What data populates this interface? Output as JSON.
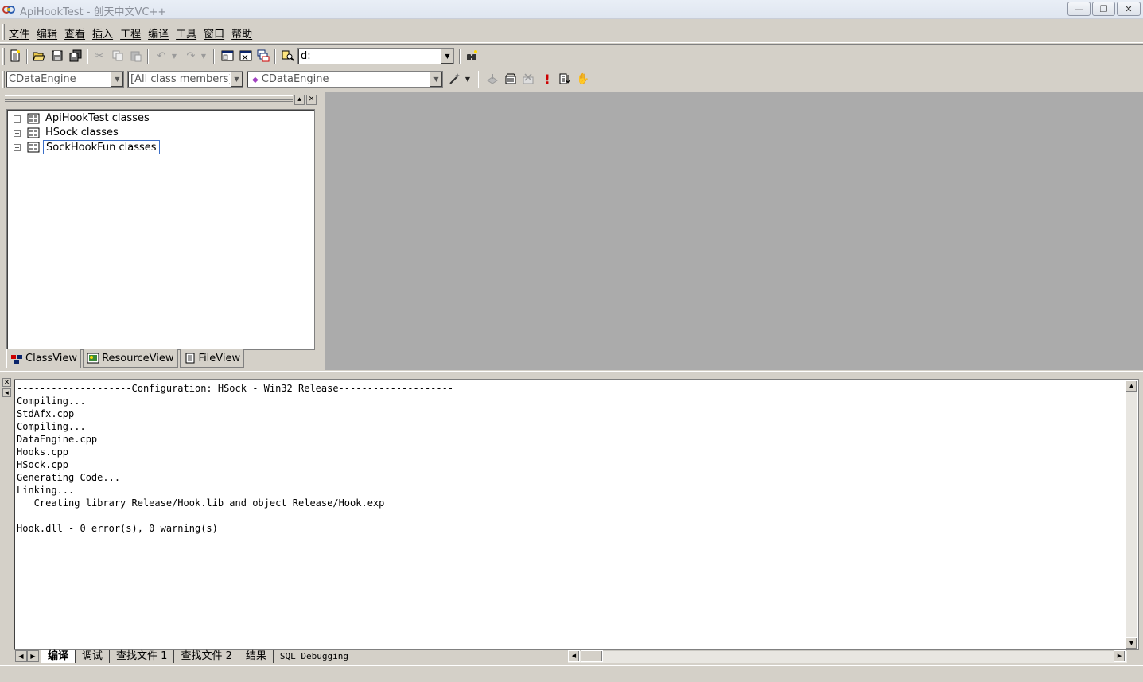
{
  "window": {
    "title": "ApiHookTest - 创天中文VC++",
    "minimize_glyph": "—",
    "maximize_glyph": "❐",
    "close_glyph": "✕"
  },
  "menu": [
    "文件",
    "编辑",
    "查看",
    "插入",
    "工程",
    "编译",
    "工具",
    "窗口",
    "帮助"
  ],
  "toolbar": {
    "find_combo_value": "d:",
    "wizard_class_combo": "CDataEngine",
    "wizard_filter_combo": "[All class members]",
    "wizard_member_combo": "CDataEngine",
    "combo_arrow": "▼"
  },
  "workspace": {
    "tree": [
      {
        "label": "ApiHookTest classes",
        "expander": "+",
        "selected": false
      },
      {
        "label": "HSock classes",
        "expander": "+",
        "selected": false
      },
      {
        "label": "SockHookFun classes",
        "expander": "+",
        "selected": true
      }
    ],
    "tabs": [
      {
        "label": "ClassView",
        "active": true
      },
      {
        "label": "ResourceView",
        "active": false
      },
      {
        "label": "FileView",
        "active": false
      }
    ],
    "dock_glyph": "▴",
    "close_glyph": "✕"
  },
  "output": {
    "lines": [
      "--------------------Configuration: HSock - Win32 Release--------------------",
      "Compiling...",
      "StdAfx.cpp",
      "Compiling...",
      "DataEngine.cpp",
      "Hooks.cpp",
      "HSock.cpp",
      "Generating Code...",
      "Linking...",
      "   Creating library Release/Hook.lib and object Release/Hook.exp",
      "",
      "Hook.dll - 0 error(s), 0 warning(s)"
    ],
    "tabs": [
      {
        "label": "编译",
        "active": true
      },
      {
        "label": "调试",
        "active": false
      },
      {
        "label": "查找文件 1",
        "active": false
      },
      {
        "label": "查找文件 2",
        "active": false
      },
      {
        "label": "结果",
        "active": false
      },
      {
        "label": "SQL Debugging",
        "active": false
      }
    ],
    "close_glyph": "✕",
    "dock_glyph": "◂",
    "scroll_up": "▲",
    "scroll_down": "▼",
    "scroll_left": "◀",
    "scroll_right": "▶"
  }
}
